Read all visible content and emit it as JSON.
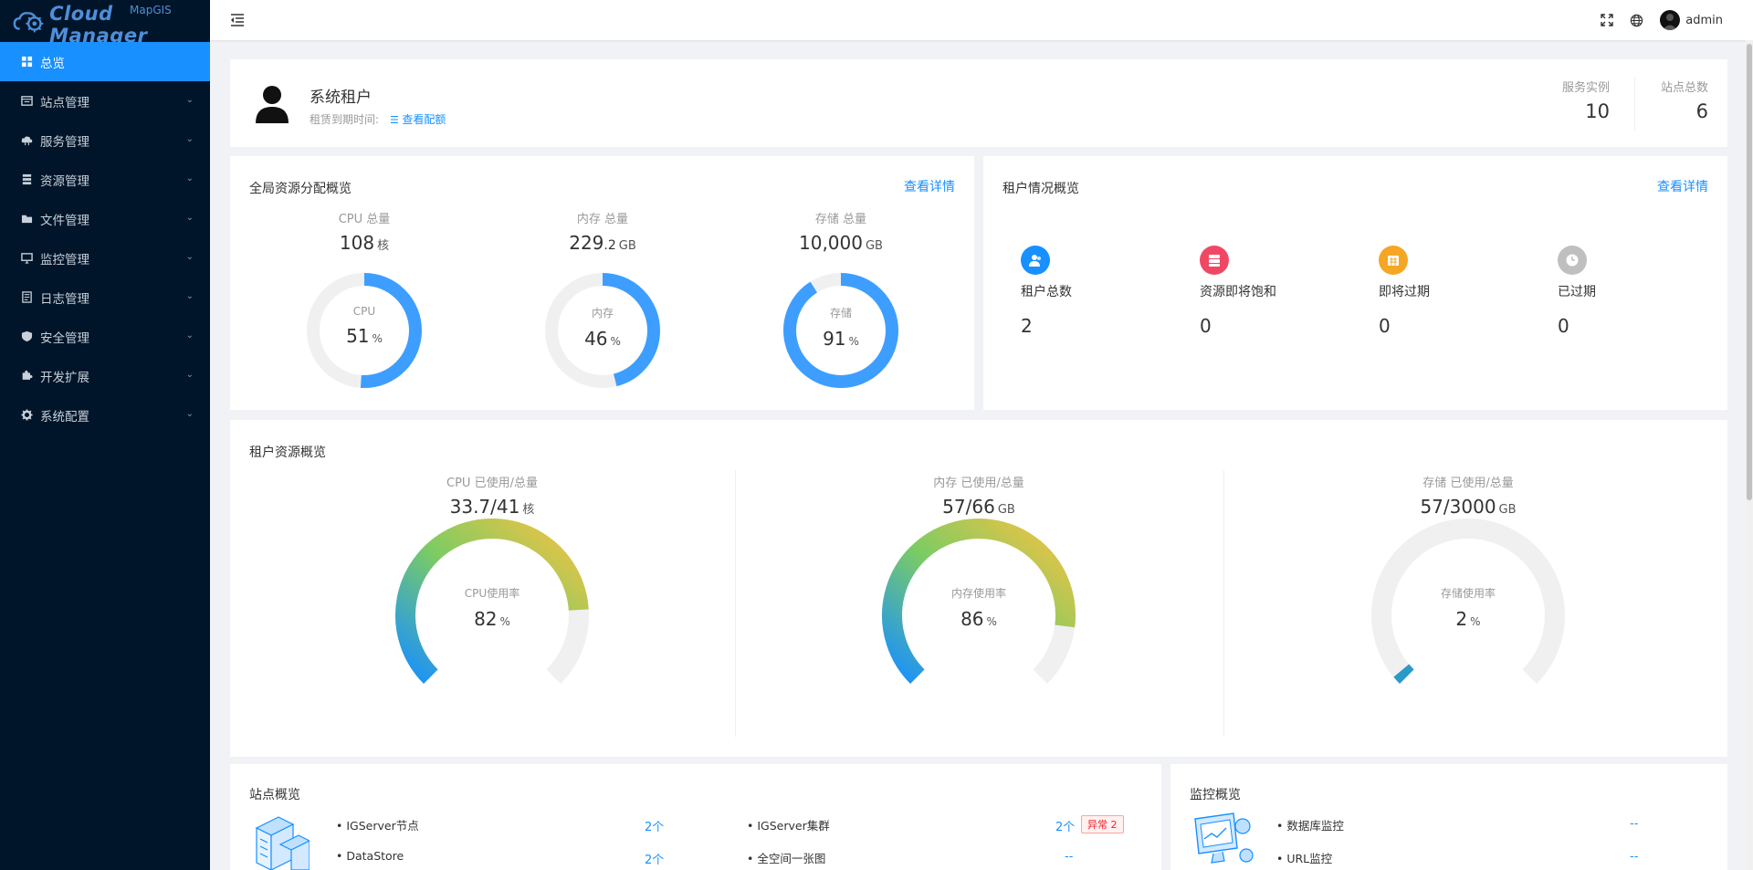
{
  "brand": {
    "name": "Cloud Manager",
    "sup": "MapGIS"
  },
  "sidebar": {
    "items": [
      {
        "label": "总览",
        "icon": "dashboard-icon"
      },
      {
        "label": "站点管理",
        "icon": "site-icon"
      },
      {
        "label": "服务管理",
        "icon": "cloud-service-icon"
      },
      {
        "label": "资源管理",
        "icon": "resource-icon"
      },
      {
        "label": "文件管理",
        "icon": "folder-icon"
      },
      {
        "label": "监控管理",
        "icon": "monitor-icon"
      },
      {
        "label": "日志管理",
        "icon": "log-icon"
      },
      {
        "label": "安全管理",
        "icon": "shield-icon"
      },
      {
        "label": "开发扩展",
        "icon": "puzzle-icon"
      },
      {
        "label": "系统配置",
        "icon": "gear-icon"
      }
    ]
  },
  "header": {
    "user": "admin"
  },
  "tenant": {
    "name": "系统租户",
    "expire_label": "租赁到期时间:",
    "quota_link": "查看配额",
    "stats": [
      {
        "label": "服务实例",
        "value": "10"
      },
      {
        "label": "站点总数",
        "value": "6"
      }
    ]
  },
  "global_resources": {
    "title": "全局资源分配概览",
    "link": "查看详情",
    "items": [
      {
        "label": "CPU 总量",
        "value": "108",
        "unit": "核",
        "center_label": "CPU",
        "percent": 51
      },
      {
        "label": "内存 总量",
        "value": "229",
        "value_suffix": ".2",
        "unit": "GB",
        "center_label": "内存",
        "percent": 46
      },
      {
        "label": "存储 总量",
        "value": "10,000",
        "unit": "GB",
        "center_label": "存储",
        "percent": 91
      }
    ],
    "percent_unit": "%"
  },
  "tenant_overview": {
    "title": "租户情况概览",
    "link": "查看详情",
    "items": [
      {
        "label": "租户总数",
        "value": "2",
        "icon": "users-icon",
        "color": "#1890ff"
      },
      {
        "label": "资源即将饱和",
        "value": "0",
        "icon": "server-icon",
        "color": "#f04864"
      },
      {
        "label": "即将过期",
        "value": "0",
        "icon": "calendar-icon",
        "color": "#f5a623"
      },
      {
        "label": "已过期",
        "value": "0",
        "icon": "clock-icon",
        "color": "#bfbfbf"
      }
    ]
  },
  "tenant_resources": {
    "title": "租户资源概览",
    "items": [
      {
        "label": "CPU 已使用/总量",
        "value": "33.7/41",
        "unit": "核",
        "center_label": "CPU使用率",
        "percent": 82
      },
      {
        "label": "内存 已使用/总量",
        "value": "57/66",
        "unit": "GB",
        "center_label": "内存使用率",
        "percent": 86
      },
      {
        "label": "存储 已使用/总量",
        "value": "57/3000",
        "unit": "GB",
        "center_label": "存储使用率",
        "percent": 2
      }
    ],
    "percent_unit": "%"
  },
  "site_overview": {
    "title": "站点概览",
    "rows": [
      {
        "label": "• IGServer节点",
        "count": "2个"
      },
      {
        "label": "• DataStore",
        "count": "2个"
      },
      {
        "label": "• IGServer集群",
        "count": "2个",
        "badge": "异常 2"
      },
      {
        "label": "• 全空间一张图",
        "count": "--"
      }
    ]
  },
  "monitor_overview": {
    "title": "监控概览",
    "rows": [
      {
        "label": "• 数据库监控",
        "count": "--"
      },
      {
        "label": "• URL监控",
        "count": "--"
      }
    ]
  }
}
